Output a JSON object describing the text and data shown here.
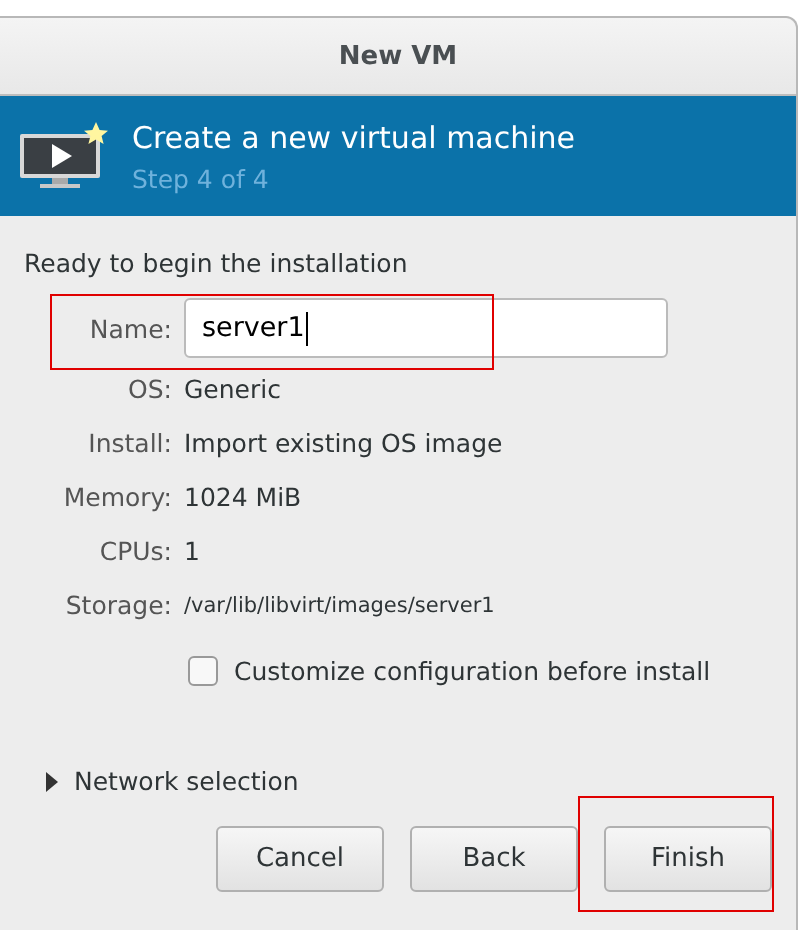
{
  "window": {
    "title": "New VM"
  },
  "banner": {
    "title": "Create a new virtual machine",
    "step": "Step 4 of 4"
  },
  "summary": {
    "heading": "Ready to begin the installation",
    "name": {
      "label": "Name:",
      "value": "server1",
      "highlighted": true
    },
    "details": [
      {
        "label": "OS:",
        "value": "Generic",
        "kind": "normal"
      },
      {
        "label": "Install:",
        "value": "Import existing OS image",
        "kind": "normal"
      },
      {
        "label": "Memory:",
        "value": "1024 MiB",
        "kind": "normal"
      },
      {
        "label": "CPUs:",
        "value": "1",
        "kind": "normal"
      },
      {
        "label": "Storage:",
        "value": "/var/lib/libvirt/images/server1",
        "kind": "path"
      }
    ]
  },
  "customize": {
    "label": "Customize configuration before install",
    "checked": false
  },
  "network": {
    "label": "Network selection",
    "expanded": false
  },
  "buttons": [
    {
      "label": "Cancel",
      "highlighted": false
    },
    {
      "label": "Back",
      "highlighted": false
    },
    {
      "label": "Finish",
      "highlighted": true
    }
  ]
}
